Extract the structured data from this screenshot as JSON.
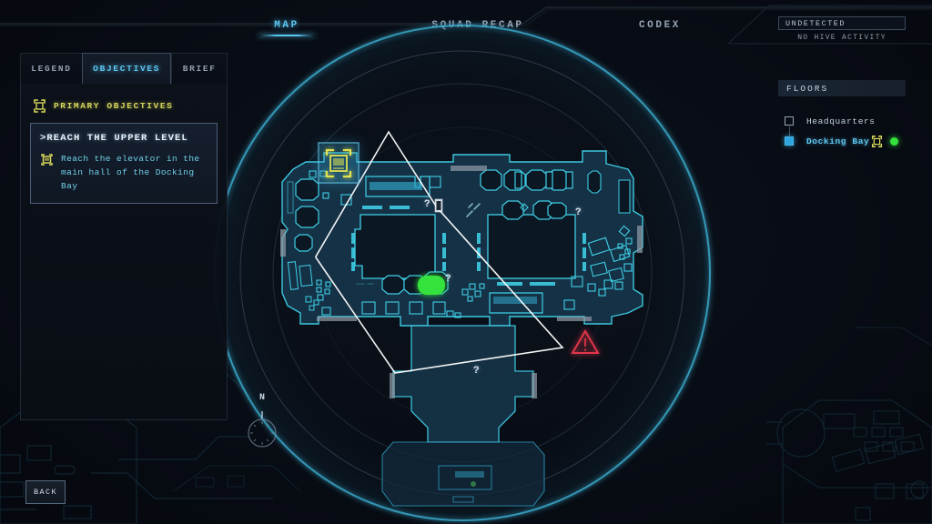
{
  "header": {
    "tabs": [
      {
        "label": "MAP",
        "active": true
      },
      {
        "label": "SQUAD RECAP",
        "active": false
      },
      {
        "label": "CODEX",
        "active": false
      }
    ]
  },
  "left_panel": {
    "tabs": [
      {
        "label": "LEGEND",
        "active": false
      },
      {
        "label": "OBJECTIVES",
        "active": true
      },
      {
        "label": "BRIEF",
        "active": false
      }
    ],
    "section_title": "PRIMARY OBJECTIVES",
    "section_icon": "objective-bracket-icon",
    "objective": {
      "title": ">REACH THE UPPER LEVEL",
      "icon": "elevator-icon",
      "description": "Reach the elevator in the main hall of the Docking Bay"
    }
  },
  "status": {
    "detection": "UNDETECTED",
    "activity": "NO HIVE ACTIVITY"
  },
  "floors": {
    "header": "FLOORS",
    "items": [
      {
        "label": "Headquarters",
        "selected": false,
        "has_objective": false,
        "has_squad": false
      },
      {
        "label": "Docking Bay",
        "selected": true,
        "has_objective": true,
        "has_squad": true
      }
    ]
  },
  "footer": {
    "back_label": "BACK"
  },
  "map": {
    "compass_north": "N",
    "unknown_markers": [
      "?",
      "?",
      "?",
      "?"
    ],
    "objective_marker": "objective-bracket-icon",
    "hazard_marker": "warning-triangle-icon",
    "squad_marker": "squad-blob-marker"
  },
  "colors": {
    "accent_cyan": "#5ec7f1",
    "objective_yellow": "#d8d85a",
    "squad_green": "#35e23d",
    "hazard_red": "#e0364a",
    "background": "#070b12",
    "map_fill": "#17374f",
    "map_stroke": "#3fd0e8"
  }
}
